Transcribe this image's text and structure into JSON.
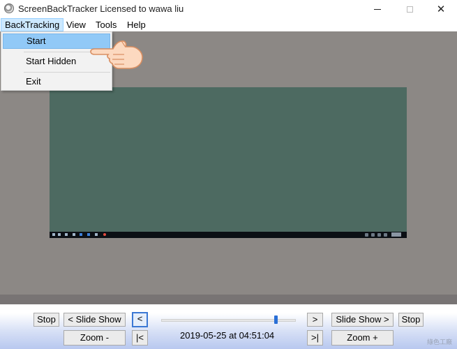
{
  "window": {
    "title": "ScreenBackTracker Licensed to wawa liu",
    "icon": "screenbacktracker-app-icon",
    "controls": {
      "minimize": "minimize-icon",
      "maximize": "maximize-icon",
      "close_glyph": "✕"
    }
  },
  "menubar": {
    "items": [
      {
        "label": "BackTracking",
        "active": true
      },
      {
        "label": "View"
      },
      {
        "label": "Tools"
      },
      {
        "label": "Help"
      }
    ]
  },
  "dropdown": {
    "items": [
      {
        "label": "Start",
        "highlighted": true
      },
      {
        "label": "Start Hidden"
      },
      {
        "label": "Exit"
      }
    ]
  },
  "preview": {
    "background_color": "#4d6a61",
    "content": "recorded desktop screenshot with avatar"
  },
  "controls": {
    "stop_left": "Stop",
    "slide_show_back": "< Slide Show",
    "prev": "<",
    "next": ">",
    "slide_show_forward": "Slide Show >",
    "stop_right": "Stop",
    "zoom_out": "Zoom -",
    "first": "|<",
    "last": ">|",
    "zoom_in": "Zoom +",
    "timestamp": "2019-05-25 at 04:51:04",
    "slider_position": 0.85
  },
  "watermark": "綠色工廠",
  "colors": {
    "menu_highlight": "#91c9f7",
    "focus_border": "#3b78d4",
    "workspace": "#8c8885"
  }
}
